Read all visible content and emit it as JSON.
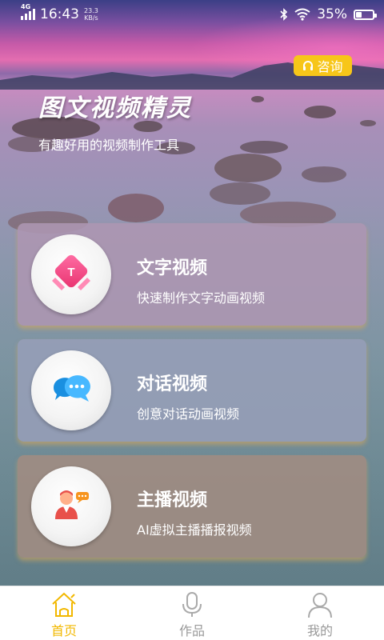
{
  "status_bar": {
    "network_type": "4G",
    "time": "16:43",
    "speed_value": "23.3",
    "speed_unit": "KB/s",
    "battery": "35%",
    "battery_level": 0.35
  },
  "header": {
    "consult_label": "咨询",
    "title": "图文视频精灵",
    "subtitle": "有趣好用的视频制作工具"
  },
  "cards": [
    {
      "title": "文字视频",
      "desc": "快速制作文字动画视频",
      "icon": "text-T-icon"
    },
    {
      "title": "对话视频",
      "desc": "创意对话动画视频",
      "icon": "chat-bubbles-icon"
    },
    {
      "title": "主播视频",
      "desc": "AI虚拟主播播报视频",
      "icon": "anchor-person-icon"
    }
  ],
  "tab_bar": {
    "items": [
      {
        "label": "首页",
        "icon": "home-icon",
        "active": true
      },
      {
        "label": "作品",
        "icon": "microphone-icon",
        "active": false
      },
      {
        "label": "我的",
        "icon": "user-icon",
        "active": false
      }
    ]
  },
  "colors": {
    "accent": "#f7c619",
    "tab_active": "#f2b800",
    "tab_inactive": "#999999"
  }
}
